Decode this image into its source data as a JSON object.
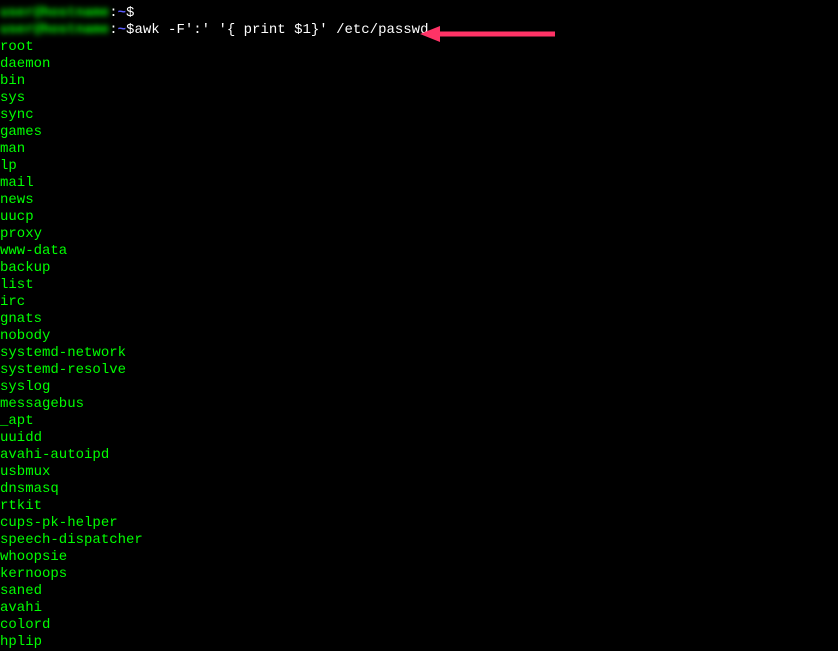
{
  "prompts": [
    {
      "user_host": "user@hostname",
      "colon": ":",
      "path": "~",
      "dollar": "$",
      "command": ""
    },
    {
      "user_host": "user@hostname",
      "colon": ":",
      "path": "~",
      "dollar": "$",
      "command": " awk -F':' '{ print $1}' /etc/passwd"
    }
  ],
  "output": [
    "root",
    "daemon",
    "bin",
    "sys",
    "sync",
    "games",
    "man",
    "lp",
    "mail",
    "news",
    "uucp",
    "proxy",
    "www-data",
    "backup",
    "list",
    "irc",
    "gnats",
    "nobody",
    "systemd-network",
    "systemd-resolve",
    "syslog",
    "messagebus",
    "_apt",
    "uuidd",
    "avahi-autoipd",
    "usbmux",
    "dnsmasq",
    "rtkit",
    "cups-pk-helper",
    "speech-dispatcher",
    "whoopsie",
    "kernoops",
    "saned",
    "avahi",
    "colord",
    "hplip"
  ],
  "annotation": {
    "arrow_color": "#ff3366"
  }
}
